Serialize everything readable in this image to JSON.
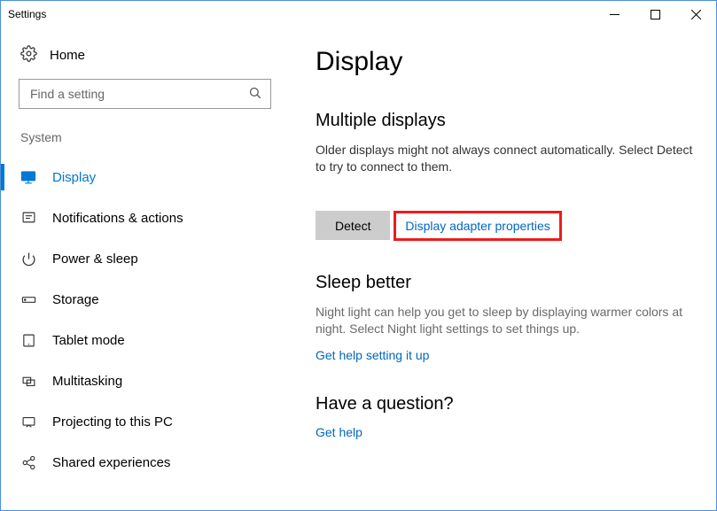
{
  "window": {
    "title": "Settings"
  },
  "sidebar": {
    "home_label": "Home",
    "search_placeholder": "Find a setting",
    "section_label": "System",
    "items": [
      {
        "label": "Display"
      },
      {
        "label": "Notifications & actions"
      },
      {
        "label": "Power & sleep"
      },
      {
        "label": "Storage"
      },
      {
        "label": "Tablet mode"
      },
      {
        "label": "Multitasking"
      },
      {
        "label": "Projecting to this PC"
      },
      {
        "label": "Shared experiences"
      }
    ]
  },
  "main": {
    "page_title": "Display",
    "multi_title": "Multiple displays",
    "multi_desc": "Older displays might not always connect automatically. Select Detect to try to connect to them.",
    "detect_label": "Detect",
    "adapter_link": "Display adapter properties",
    "sleep_title": "Sleep better",
    "sleep_desc": "Night light can help you get to sleep by displaying warmer colors at night. Select Night light settings to set things up.",
    "sleep_link": "Get help setting it up",
    "question_title": "Have a question?",
    "question_link": "Get help"
  }
}
